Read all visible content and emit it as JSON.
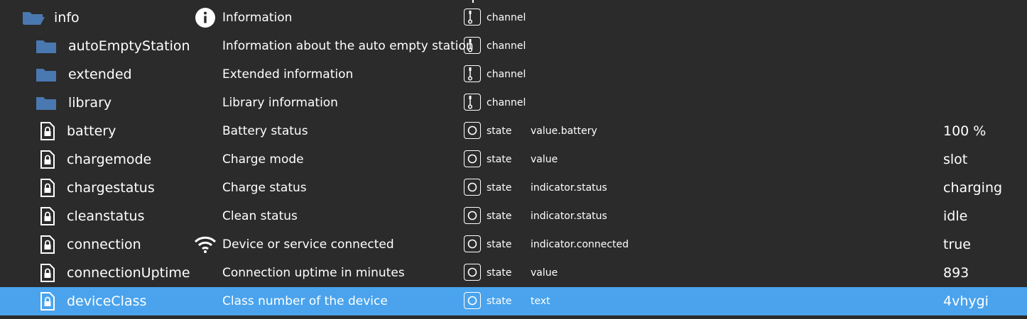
{
  "rows": [
    {
      "name": "info",
      "description": "Information",
      "type": "channel",
      "role": "",
      "value": "",
      "icon": "folder-open-icon",
      "desc_icon": "info-circle-icon"
    },
    {
      "name": "autoEmptyStation",
      "description": "Information about the auto empty station",
      "type": "channel",
      "role": "",
      "value": "",
      "icon": "folder-icon",
      "desc_icon": ""
    },
    {
      "name": "extended",
      "description": "Extended information",
      "type": "channel",
      "role": "",
      "value": "",
      "icon": "folder-icon",
      "desc_icon": ""
    },
    {
      "name": "library",
      "description": "Library information",
      "type": "channel",
      "role": "",
      "value": "",
      "icon": "folder-icon",
      "desc_icon": ""
    },
    {
      "name": "battery",
      "description": "Battery status",
      "type": "state",
      "role": "value.battery",
      "value": "100 %",
      "icon": "locked-file-icon",
      "desc_icon": ""
    },
    {
      "name": "chargemode",
      "description": "Charge mode",
      "type": "state",
      "role": "value",
      "value": "slot",
      "icon": "locked-file-icon",
      "desc_icon": ""
    },
    {
      "name": "chargestatus",
      "description": "Charge status",
      "type": "state",
      "role": "indicator.status",
      "value": "charging",
      "icon": "locked-file-icon",
      "desc_icon": ""
    },
    {
      "name": "cleanstatus",
      "description": "Clean status",
      "type": "state",
      "role": "indicator.status",
      "value": "idle",
      "icon": "locked-file-icon",
      "desc_icon": ""
    },
    {
      "name": "connection",
      "description": "Device or service connected",
      "type": "state",
      "role": "indicator.connected",
      "value": "true",
      "icon": "locked-file-icon",
      "desc_icon": "wifi-icon"
    },
    {
      "name": "connectionUptime",
      "description": "Connection uptime in minutes",
      "type": "state",
      "role": "value",
      "value": "893",
      "icon": "locked-file-icon",
      "desc_icon": ""
    },
    {
      "name": "deviceClass",
      "description": "Class number of the device",
      "type": "state",
      "role": "text",
      "value": "4vhygi",
      "icon": "locked-file-icon",
      "desc_icon": "",
      "selected": true
    }
  ],
  "colors": {
    "background": "#2b2b2b",
    "selected": "#4aa3ec",
    "folder": "#4a78b0"
  }
}
